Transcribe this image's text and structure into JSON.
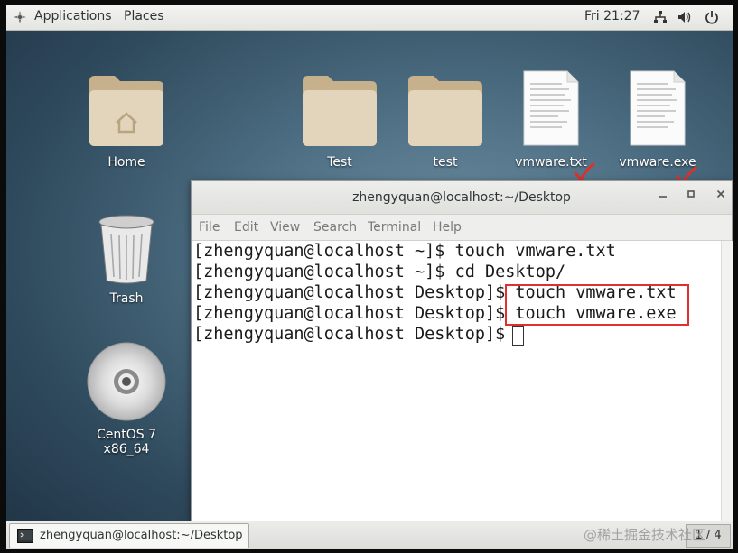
{
  "topbar": {
    "applications_label": "Applications",
    "places_label": "Places",
    "clock": "Fri 21:27"
  },
  "desktop": {
    "icons": [
      {
        "label": "Home",
        "icon": "home-folder-icon"
      },
      {
        "label": "Test",
        "icon": "folder-icon"
      },
      {
        "label": "test",
        "icon": "folder-icon"
      },
      {
        "label": "vmware.txt",
        "icon": "text-file-icon"
      },
      {
        "label": "vmware.exe",
        "icon": "text-file-icon"
      },
      {
        "label": "Trash",
        "icon": "trash-icon"
      },
      {
        "label": "CentOS 7 x86_64",
        "icon": "optical-disc-icon"
      }
    ]
  },
  "terminal": {
    "title": "zhengyquan@localhost:~/Desktop",
    "menu": [
      "File",
      "Edit",
      "View",
      "Search",
      "Terminal",
      "Help"
    ],
    "lines": [
      "[zhengyquan@localhost ~]$ touch vmware.txt",
      "[zhengyquan@localhost ~]$ cd Desktop/",
      "[zhengyquan@localhost Desktop]$ touch vmware.txt",
      "[zhengyquan@localhost Desktop]$ touch vmware.exe",
      "[zhengyquan@localhost Desktop]$ "
    ]
  },
  "taskbar": {
    "window_label": "zhengyquan@localhost:~/Desktop",
    "workspace": "1 / 4"
  },
  "watermark": "@稀土掘金技术社区",
  "colors": {
    "annotation_red": "#e0302b",
    "folder": "#d9c9a8"
  }
}
